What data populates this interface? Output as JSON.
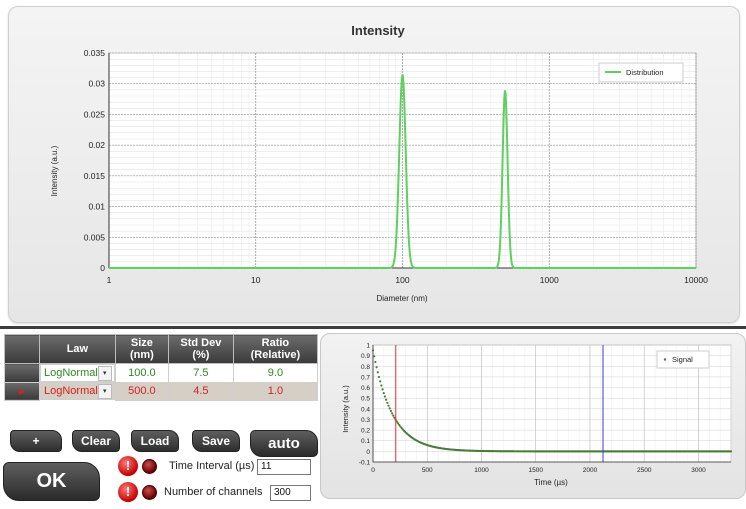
{
  "intensity_chart": {
    "title": "Intensity",
    "xlabel": "Diameter (nm)",
    "ylabel": "Intensity (a.u.)",
    "legend": "Distribution"
  },
  "signal_chart": {
    "xlabel": "Time (µs)",
    "ylabel": "Intensity (a.u.)",
    "legend": "Signal"
  },
  "chart_data": [
    {
      "type": "line",
      "title": "Intensity",
      "xlabel": "Diameter (nm)",
      "ylabel": "Intensity (a.u.)",
      "x_scale": "log",
      "xlim": [
        1,
        10000
      ],
      "ylim": [
        0,
        0.035
      ],
      "x_ticks": [
        "1",
        "10",
        "100",
        "1000",
        "10000"
      ],
      "y_ticks": [
        "0",
        "0.005",
        "0.01",
        "0.015",
        "0.02",
        "0.025",
        "0.03",
        "0.035"
      ],
      "grid": true,
      "legend_position": "top-right",
      "series": [
        {
          "name": "Distribution",
          "color": "#5ed05e",
          "peaks": [
            {
              "center": 100,
              "height": 0.0315,
              "sigma_log10": 0.022
            },
            {
              "center": 500,
              "height": 0.029,
              "sigma_log10": 0.017
            }
          ]
        }
      ]
    },
    {
      "type": "scatter",
      "xlabel": "Time (µs)",
      "ylabel": "Intensity (a.u.)",
      "xlim": [
        0,
        3300
      ],
      "ylim": [
        -0.1,
        1.0
      ],
      "x_ticks": [
        "0",
        "500",
        "1000",
        "1500",
        "2000",
        "2500",
        "3000"
      ],
      "y_ticks": [
        "-0.1",
        "0",
        "0.1",
        "0.2",
        "0.3",
        "0.4",
        "0.5",
        "0.6",
        "0.7",
        "0.8",
        "0.9",
        "1"
      ],
      "grid": true,
      "legend_position": "top-right",
      "series": [
        {
          "name": "Signal",
          "color": "#4a7a3a",
          "model": "exponential decay",
          "amplitude": 0.95,
          "tau": 180
        }
      ],
      "markers": [
        {
          "x": 210,
          "color": "#e03030"
        },
        {
          "x": 2120,
          "color": "#3a3ae0"
        }
      ]
    }
  ],
  "table": {
    "headers": [
      "Law",
      "Size (nm)",
      "Std Dev (%)",
      "Ratio (Relative)"
    ],
    "rows": [
      {
        "law": "LogNormal",
        "size": "100.0",
        "std": "7.5",
        "ratio": "9.0"
      },
      {
        "law": "LogNormal",
        "size": "500.0",
        "std": "4.5",
        "ratio": "1.0"
      }
    ]
  },
  "buttons": {
    "add": "+",
    "clear": "Clear",
    "load": "Load",
    "save": "Save",
    "auto": "auto",
    "ok": "OK"
  },
  "settings": {
    "time_interval_label": "Time Interval (µs)",
    "time_interval_value": "11",
    "channels_label": "Number of channels",
    "channels_value": "300"
  },
  "colors": {
    "distribution": "#5ed05e",
    "signal": "#4a7a3a",
    "row_selected_text": "#d42020",
    "row_text": "#2f8a20"
  }
}
